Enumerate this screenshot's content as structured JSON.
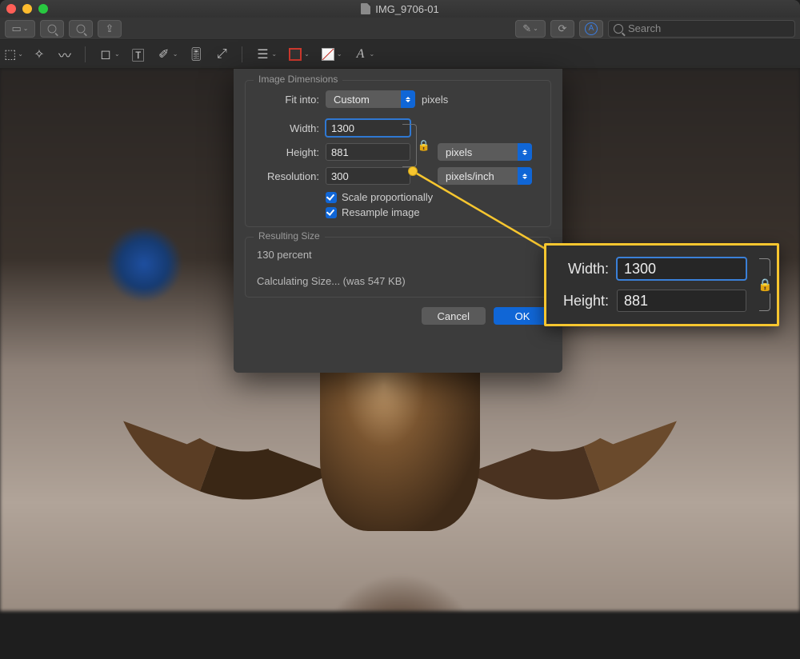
{
  "window": {
    "title": "IMG_9706-01"
  },
  "search": {
    "placeholder": "Search"
  },
  "dialog": {
    "section_dimensions_title": "Image Dimensions",
    "fit_label": "Fit into:",
    "fit_value": "Custom",
    "fit_unit": "pixels",
    "width_label": "Width:",
    "width_value": "1300",
    "height_label": "Height:",
    "height_value": "881",
    "wh_unit_value": "pixels",
    "resolution_label": "Resolution:",
    "resolution_value": "300",
    "resolution_unit_value": "pixels/inch",
    "scale_label": "Scale proportionally",
    "resample_label": "Resample image",
    "section_result_title": "Resulting Size",
    "result_percent": "130 percent",
    "result_size": "Calculating Size... (was 547 KB)",
    "cancel": "Cancel",
    "ok": "OK"
  },
  "callout": {
    "width_label": "Width:",
    "width_value": "1300",
    "height_label": "Height:",
    "height_value": "881"
  }
}
